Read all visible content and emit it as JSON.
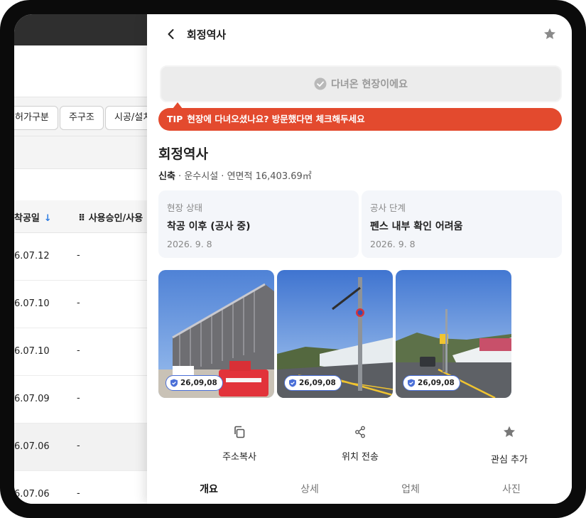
{
  "background": {
    "filter_chips": [
      "허가구분",
      "주구조",
      "시공/설치"
    ],
    "columns": [
      "착공일",
      "사용승인/사용"
    ],
    "rows": [
      {
        "date": "6.07.12",
        "value": "-"
      },
      {
        "date": "6.07.10",
        "value": "-"
      },
      {
        "date": "6.07.10",
        "value": "-"
      },
      {
        "date": "6.07.09",
        "value": "-"
      },
      {
        "date": "6.07.06",
        "value": "-"
      },
      {
        "date": "6.07.06",
        "value": "-"
      }
    ]
  },
  "panel": {
    "header_title": "회정역사",
    "visited_button": "다녀온 현장이에요",
    "tip": {
      "tag": "TIP",
      "text": "현장에 다녀오셨나요? 방문했다면 체크해두세요"
    },
    "site": {
      "name": "회정역사",
      "type": "신축",
      "category": "운수시설",
      "area_label": "연면적",
      "area": "16,403.69㎡"
    },
    "status_cards": [
      {
        "label": "현장 상태",
        "value": "착공 이후 (공사 중)",
        "date": "2026. 9. 8"
      },
      {
        "label": "공사 단계",
        "value": "펜스 내부 확인 어려움",
        "date": "2026. 9. 8"
      }
    ],
    "photos": [
      {
        "stamp": "26,09,08"
      },
      {
        "stamp": "26,09,08"
      },
      {
        "stamp": "26,09,08"
      }
    ],
    "actions": [
      {
        "label": "주소복사",
        "icon": "copy-icon"
      },
      {
        "label": "위치 전송",
        "icon": "share-icon"
      },
      {
        "label": "관심 추가",
        "icon": "star-icon"
      }
    ],
    "tabs": [
      "개요",
      "상세",
      "업체",
      "사진"
    ],
    "active_tab": "개요"
  },
  "colors": {
    "tip_bg": "#e34a2e",
    "card_bg": "#f4f6fa",
    "stamp_border": "#4a6fd8",
    "sort_arrow": "#2f7de1"
  }
}
